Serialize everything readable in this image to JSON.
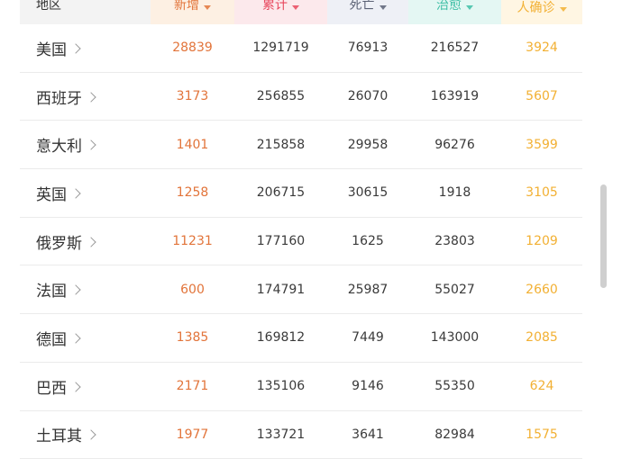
{
  "headers": {
    "region": "地区",
    "new": "新增",
    "total": "累计",
    "death": "死亡",
    "cured": "治愈",
    "import": "人确诊"
  },
  "rows": [
    {
      "region": "美国",
      "new": "28839",
      "total": "1291719",
      "death": "76913",
      "cured": "216527",
      "import": "3924"
    },
    {
      "region": "西班牙",
      "new": "3173",
      "total": "256855",
      "death": "26070",
      "cured": "163919",
      "import": "5607"
    },
    {
      "region": "意大利",
      "new": "1401",
      "total": "215858",
      "death": "29958",
      "cured": "96276",
      "import": "3599"
    },
    {
      "region": "英国",
      "new": "1258",
      "total": "206715",
      "death": "30615",
      "cured": "1918",
      "import": "3105"
    },
    {
      "region": "俄罗斯",
      "new": "11231",
      "total": "177160",
      "death": "1625",
      "cured": "23803",
      "import": "1209"
    },
    {
      "region": "法国",
      "new": "600",
      "total": "174791",
      "death": "25987",
      "cured": "55027",
      "import": "2660"
    },
    {
      "region": "德国",
      "new": "1385",
      "total": "169812",
      "death": "7449",
      "cured": "143000",
      "import": "2085"
    },
    {
      "region": "巴西",
      "new": "2171",
      "total": "135106",
      "death": "9146",
      "cured": "55350",
      "import": "624"
    },
    {
      "region": "土耳其",
      "new": "1977",
      "total": "133721",
      "death": "3641",
      "cured": "82984",
      "import": "1575"
    }
  ],
  "colors": {
    "new": "#e2743a",
    "total": "#e8485e",
    "death": "#5b6275",
    "cured": "#3fbfa6",
    "import": "#f2b033"
  },
  "icons": {
    "sort": "sort-down-icon",
    "row_arrow": "chevron-right-icon"
  }
}
